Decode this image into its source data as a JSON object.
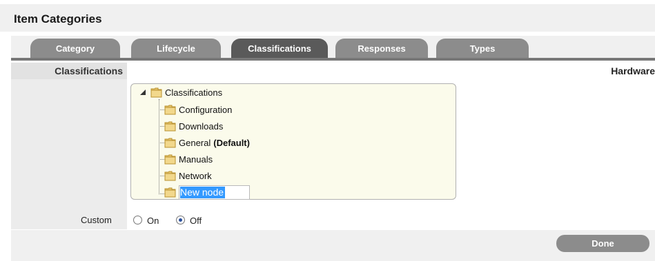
{
  "page": {
    "title": "Item Categories"
  },
  "tabs": [
    {
      "label": "Category",
      "active": false
    },
    {
      "label": "Lifecycle",
      "active": false
    },
    {
      "label": "Classifications",
      "active": true
    },
    {
      "label": "Responses",
      "active": false
    },
    {
      "label": "Types",
      "active": false
    }
  ],
  "left_panel": {
    "header": "Classifications"
  },
  "category_name": "Hardware",
  "tree": {
    "root": "Classifications",
    "children": [
      {
        "label": "Configuration"
      },
      {
        "label": "Downloads"
      },
      {
        "label": "General",
        "suffix": "(Default)"
      },
      {
        "label": "Manuals"
      },
      {
        "label": "Network"
      }
    ],
    "editing": {
      "value": "New node"
    }
  },
  "custom": {
    "label": "Custom",
    "on_label": "On",
    "off_label": "Off",
    "selected": "off"
  },
  "footer": {
    "done_label": "Done"
  },
  "colors": {
    "tab_inactive": "#8c8c8c",
    "tab_active": "#5a5a5a",
    "tree_bg": "#fbfbeb",
    "selection": "#3399ff"
  }
}
